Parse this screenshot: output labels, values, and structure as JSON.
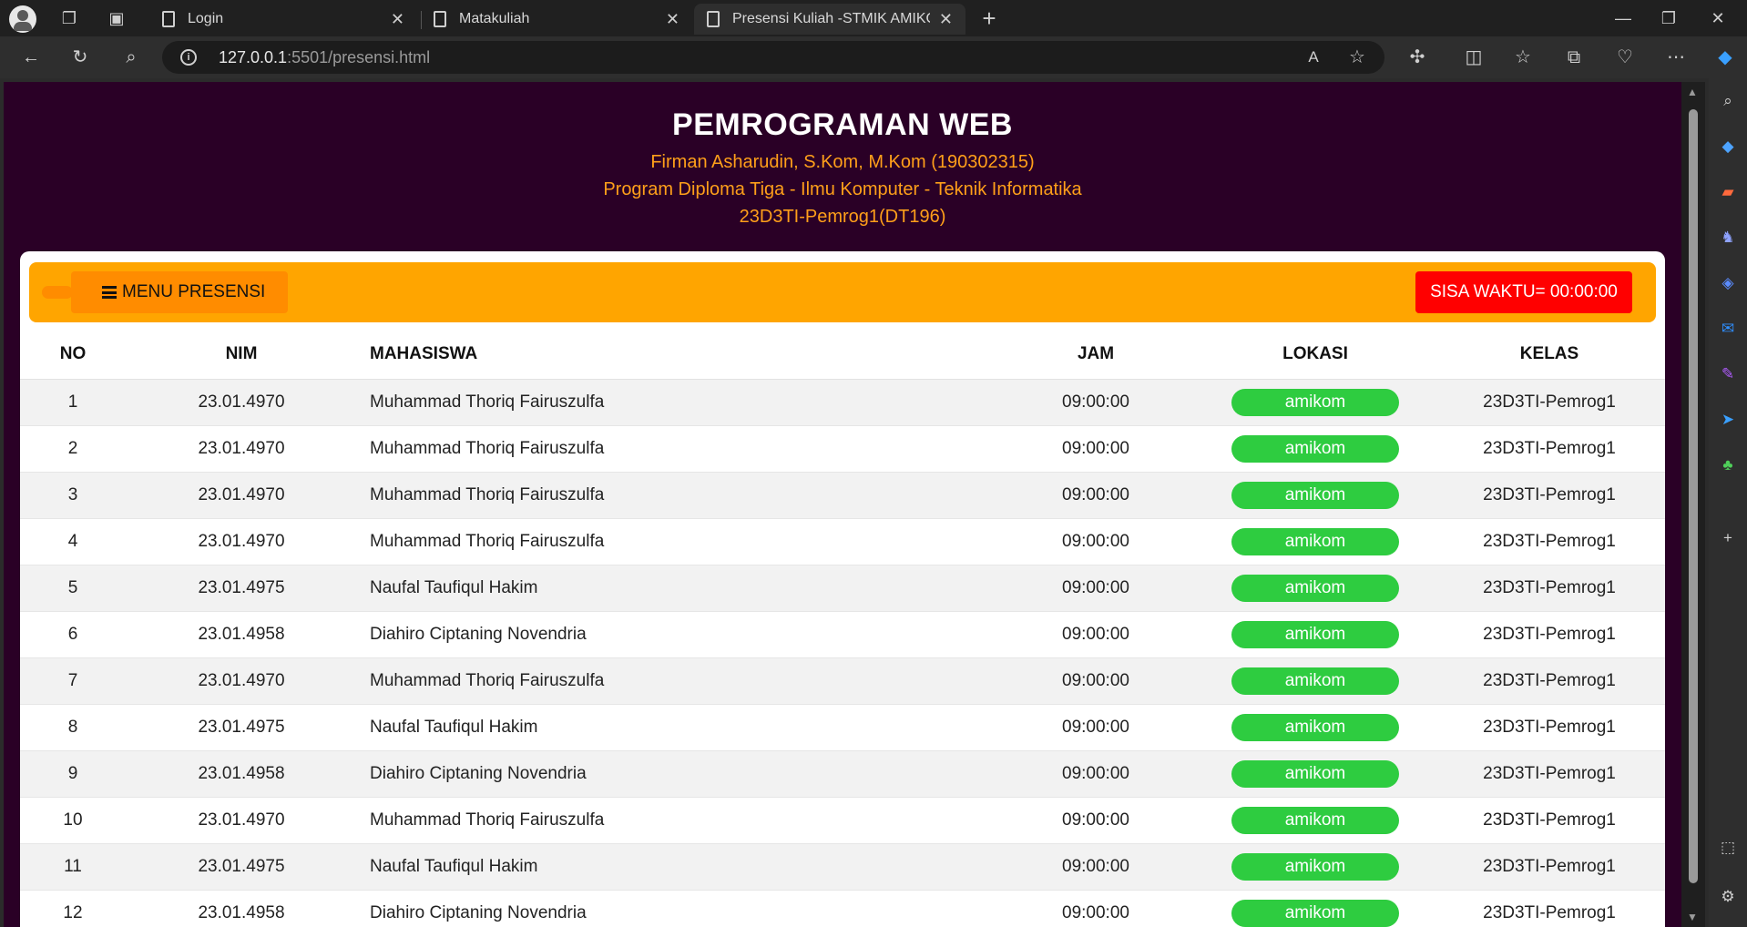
{
  "browser": {
    "tabs": [
      {
        "label": "Login",
        "active": false
      },
      {
        "label": "Matakuliah",
        "active": false
      },
      {
        "label": "Presensi Kuliah -STMIK AMIKOM",
        "active": true
      }
    ],
    "url_host": "127.0.0.1",
    "url_rest": ":5501/presensi.html",
    "new_tab": "+",
    "icons": [
      "back-icon",
      "refresh-icon",
      "search-icon",
      "read-aloud-icon",
      "favorite-star-icon",
      "extensions-icon",
      "split-screen-icon",
      "favorites-icon",
      "collections-icon",
      "browser-essentials-icon",
      "more-icon",
      "copilot-icon"
    ],
    "sidebar_icons": [
      "search-icon",
      "tag-icon",
      "toolbox-icon",
      "games-icon",
      "copilot-icon",
      "outlook-icon",
      "designer-icon",
      "send-icon",
      "tree-icon",
      "add-icon",
      "screenshot-icon",
      "settings-icon"
    ]
  },
  "header": {
    "title": "PEMROGRAMAN WEB",
    "lecturer": "Firman Asharudin, S.Kom, M.Kom (190302315)",
    "program": "Program Diploma Tiga - Ilmu Komputer - Teknik Informatika",
    "class_code": "23D3TI-Pemrog1(DT196)"
  },
  "menu": {
    "button_label": "MENU PRESENSI",
    "timer_label": "SISA WAKTU= 00:00:00"
  },
  "colors": {
    "header_bg": "#2a0026",
    "accent": "#ffa500",
    "menu_button": "#ff8c00",
    "timer": "#ff0000",
    "badge": "#2ecc40",
    "subtitle_text": "#ff9f1a"
  },
  "table": {
    "columns": [
      "NO",
      "NIM",
      "MAHASISWA",
      "JAM",
      "LOKASI",
      "KELAS"
    ],
    "rows": [
      {
        "no": "1",
        "nim": "23.01.4970",
        "name": "Muhammad Thoriq Fairuszulfa",
        "jam": "09:00:00",
        "lokasi": "amikom",
        "kelas": "23D3TI-Pemrog1"
      },
      {
        "no": "2",
        "nim": "23.01.4970",
        "name": "Muhammad Thoriq Fairuszulfa",
        "jam": "09:00:00",
        "lokasi": "amikom",
        "kelas": "23D3TI-Pemrog1"
      },
      {
        "no": "3",
        "nim": "23.01.4970",
        "name": "Muhammad Thoriq Fairuszulfa",
        "jam": "09:00:00",
        "lokasi": "amikom",
        "kelas": "23D3TI-Pemrog1"
      },
      {
        "no": "4",
        "nim": "23.01.4970",
        "name": "Muhammad Thoriq Fairuszulfa",
        "jam": "09:00:00",
        "lokasi": "amikom",
        "kelas": "23D3TI-Pemrog1"
      },
      {
        "no": "5",
        "nim": "23.01.4975",
        "name": "Naufal Taufiqul Hakim",
        "jam": "09:00:00",
        "lokasi": "amikom",
        "kelas": "23D3TI-Pemrog1"
      },
      {
        "no": "6",
        "nim": "23.01.4958",
        "name": "Diahiro Ciptaning Novendria",
        "jam": "09:00:00",
        "lokasi": "amikom",
        "kelas": "23D3TI-Pemrog1"
      },
      {
        "no": "7",
        "nim": "23.01.4970",
        "name": "Muhammad Thoriq Fairuszulfa",
        "jam": "09:00:00",
        "lokasi": "amikom",
        "kelas": "23D3TI-Pemrog1"
      },
      {
        "no": "8",
        "nim": "23.01.4975",
        "name": "Naufal Taufiqul Hakim",
        "jam": "09:00:00",
        "lokasi": "amikom",
        "kelas": "23D3TI-Pemrog1"
      },
      {
        "no": "9",
        "nim": "23.01.4958",
        "name": "Diahiro Ciptaning Novendria",
        "jam": "09:00:00",
        "lokasi": "amikom",
        "kelas": "23D3TI-Pemrog1"
      },
      {
        "no": "10",
        "nim": "23.01.4970",
        "name": "Muhammad Thoriq Fairuszulfa",
        "jam": "09:00:00",
        "lokasi": "amikom",
        "kelas": "23D3TI-Pemrog1"
      },
      {
        "no": "11",
        "nim": "23.01.4975",
        "name": "Naufal Taufiqul Hakim",
        "jam": "09:00:00",
        "lokasi": "amikom",
        "kelas": "23D3TI-Pemrog1"
      },
      {
        "no": "12",
        "nim": "23.01.4958",
        "name": "Diahiro Ciptaning Novendria",
        "jam": "09:00:00",
        "lokasi": "amikom",
        "kelas": "23D3TI-Pemrog1"
      }
    ]
  }
}
